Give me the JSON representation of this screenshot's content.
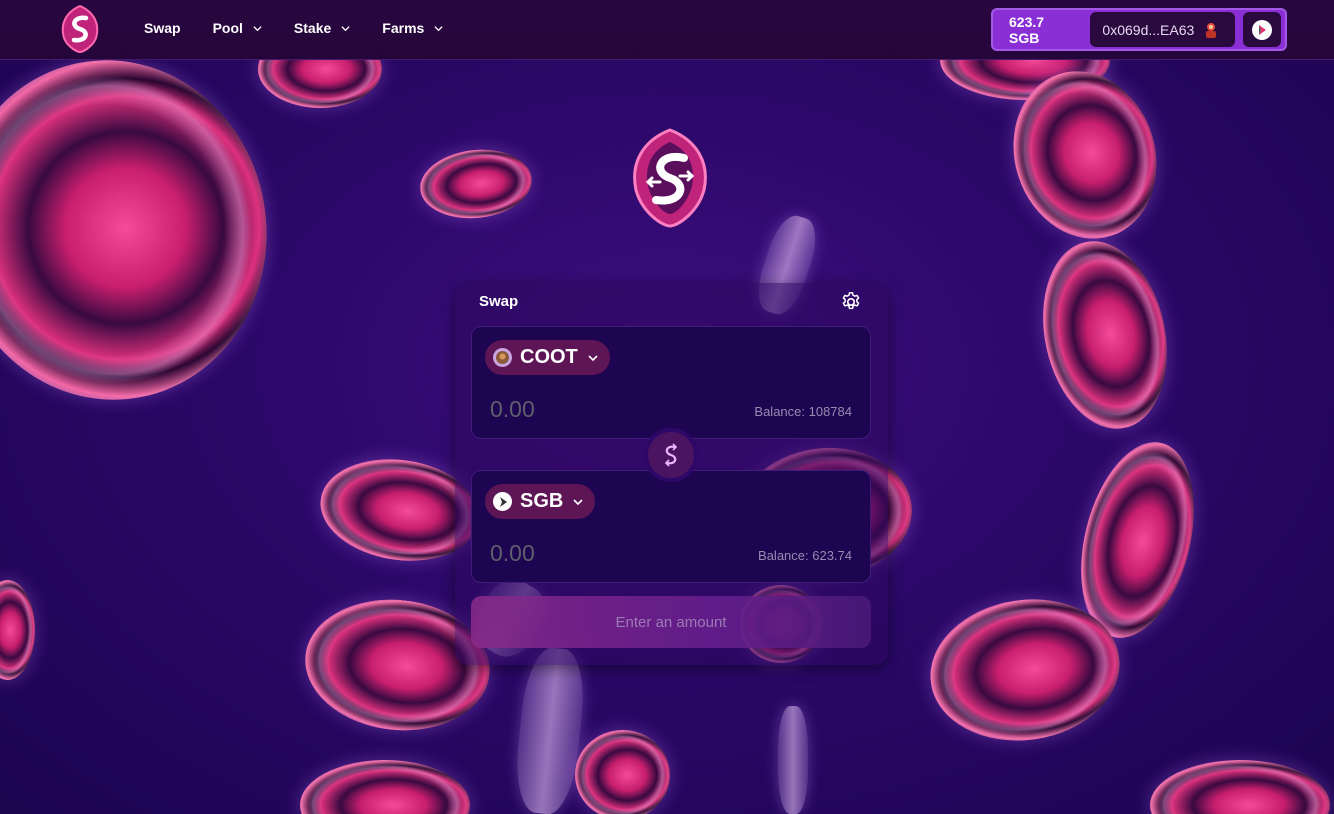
{
  "nav": {
    "items": [
      {
        "label": "Swap",
        "has_dropdown": false
      },
      {
        "label": "Pool",
        "has_dropdown": true
      },
      {
        "label": "Stake",
        "has_dropdown": true
      },
      {
        "label": "Farms",
        "has_dropdown": true
      }
    ],
    "logo_icon": "spark-s-logo-icon"
  },
  "wallet": {
    "balance": "623.7 SGB",
    "address": "0x069d...EA63",
    "avatar_icon": "user-avatar-icon",
    "network_icon": "songbird-icon"
  },
  "swap": {
    "title": "Swap",
    "settings_icon": "gear-icon",
    "from": {
      "token": "COOT",
      "icon": "coot-token-icon",
      "placeholder": "0.00",
      "balance": "Balance: 108784"
    },
    "to": {
      "token": "SGB",
      "icon": "sgb-token-icon",
      "placeholder": "0.00",
      "balance": "Balance: 623.74"
    },
    "switch_icon": "swap-direction-icon",
    "action_label": "Enter an amount"
  },
  "colors": {
    "background": "#2a0868",
    "navbar": "#25063a",
    "wallet_accent": "#8a2fd6",
    "token_box": "#1e0552",
    "token_pill": "#5e1555",
    "brand_pink": "#e8337f"
  }
}
